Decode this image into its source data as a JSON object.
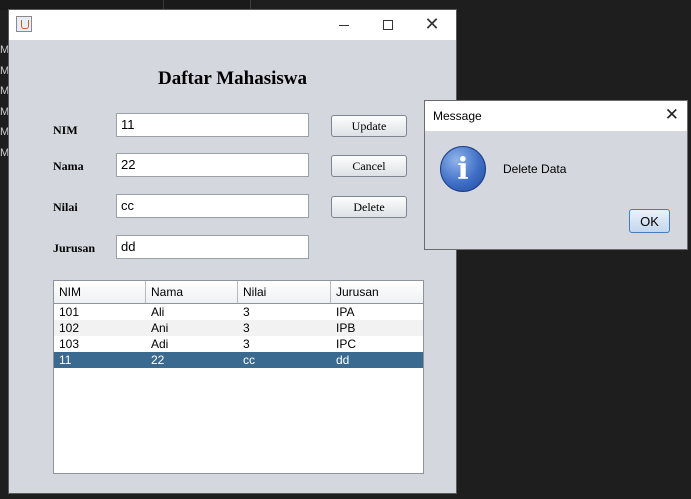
{
  "background": {
    "left_letters": [
      "M",
      "M",
      "M",
      "M",
      "M",
      "M",
      "M",
      "M"
    ]
  },
  "main_window": {
    "title_bar": {
      "minimize": "—",
      "maximize": "☐",
      "close": "✕"
    },
    "heading": "Daftar Mahasiswa",
    "form": {
      "nim_label": "NIM",
      "nim_value": "11",
      "nama_label": "Nama",
      "nama_value": "22",
      "nilai_label": "Nilai",
      "nilai_value": "cc",
      "jurusan_label": "Jurusan",
      "jurusan_value": "dd"
    },
    "buttons": {
      "update": "Update",
      "cancel": "Cancel",
      "delete": "Delete"
    },
    "table": {
      "columns": [
        "NIM",
        "Nama",
        "Nilai",
        "Jurusan"
      ],
      "rows": [
        [
          "101",
          "Ali",
          "3",
          "IPA"
        ],
        [
          "102",
          "Ani",
          "3",
          "IPB"
        ],
        [
          "103",
          "Adi",
          "3",
          "IPC"
        ],
        [
          "11",
          "22",
          "cc",
          "dd"
        ]
      ],
      "selected_row": 3,
      "selected_color": "#3a6a8f"
    }
  },
  "dialog": {
    "title": "Message",
    "message": "Delete Data",
    "icon": "info-icon",
    "ok_label": "OK"
  }
}
